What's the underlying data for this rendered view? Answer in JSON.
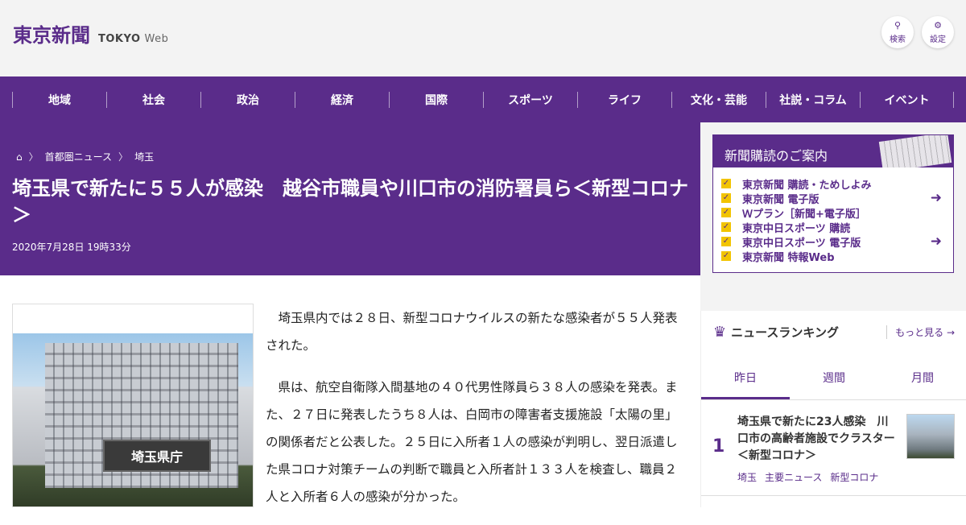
{
  "header": {
    "logo_jp": "東京新聞",
    "logo_en": "TOKYO",
    "logo_web": "Web",
    "search_label": "検索",
    "settings_label": "設定"
  },
  "nav": [
    "地域",
    "社会",
    "政治",
    "経済",
    "国際",
    "スポーツ",
    "ライフ",
    "文化・芸能",
    "社説・コラム",
    "イベント"
  ],
  "breadcrumb": [
    "首都圏ニュース",
    "埼玉"
  ],
  "article": {
    "title": "埼玉県で新たに５５人が感染　越谷市職員や川口市の消防署員ら＜新型コロナ＞",
    "date": "2020年7月28日 19時33分",
    "photo_sign": "埼玉県庁",
    "paragraphs": [
      "埼玉県内では２８日、新型コロナウイルスの新たな感染者が５５人発表された。",
      "県は、航空自衛隊入間基地の４０代男性隊員ら３８人の感染を発表。また、２７日に発表したうち８人は、白岡市の障害者支援施設「太陽の里」の関係者だと公表した。２５日に入所者１人の感染が判明し、翌日派遣した県コロナ対策チームの判断で職員と入所者計１３３人を検査し、職員２人と入所者６人の感染が分かった。"
    ]
  },
  "subscription": {
    "heading": "新聞購読のご案内",
    "items": [
      {
        "label": "東京新聞 購読・ためしよみ",
        "login": false
      },
      {
        "label": "東京新聞 電子版",
        "login": true
      },
      {
        "label": "Ｗプラン［新聞+電子版］",
        "login": false
      },
      {
        "label": "東京中日スポーツ 購読",
        "login": false
      },
      {
        "label": "東京中日スポーツ 電子版",
        "login": true
      },
      {
        "label": "東京新聞 特報Web",
        "login": false
      }
    ]
  },
  "ranking": {
    "title": "ニュースランキング",
    "more": "もっと見る",
    "tabs": [
      "昨日",
      "週間",
      "月間"
    ],
    "active_tab": "昨日",
    "items": [
      {
        "rank": "1",
        "title": "埼玉県で新たに23人感染　川口市の高齢者施設でクラスター＜新型コロナ＞",
        "tags": [
          "埼玉",
          "主要ニュース",
          "新型コロナ"
        ]
      }
    ]
  },
  "colors": {
    "brand": "#5a2c8a",
    "accent": "#f2c400"
  }
}
